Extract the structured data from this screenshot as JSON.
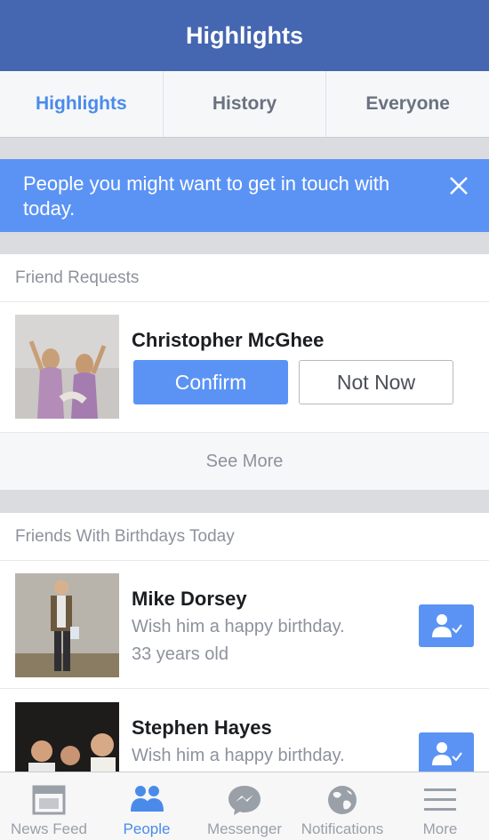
{
  "navbar": {
    "title": "Highlights"
  },
  "tabs": [
    {
      "label": "Highlights",
      "active": true
    },
    {
      "label": "History",
      "active": false
    },
    {
      "label": "Everyone",
      "active": false
    }
  ],
  "banner": {
    "text": "People you might want to get in touch with today."
  },
  "friend_requests": {
    "header": "Friend Requests",
    "name": "Christopher McGhee",
    "confirm_label": "Confirm",
    "not_now_label": "Not Now",
    "see_more_label": "See More"
  },
  "birthdays": {
    "header": "Friends With Birthdays Today",
    "people": [
      {
        "name": "Mike Dorsey",
        "message": "Wish him a happy birthday.",
        "age": "33 years old"
      },
      {
        "name": "Stephen Hayes",
        "message": "Wish him a happy birthday."
      }
    ]
  },
  "tabbar": [
    {
      "label": "News Feed",
      "icon": "news-feed-icon",
      "active": false
    },
    {
      "label": "People",
      "icon": "people-icon",
      "active": true
    },
    {
      "label": "Messenger",
      "icon": "messenger-icon",
      "active": false
    },
    {
      "label": "Notifications",
      "icon": "globe-icon",
      "active": false
    },
    {
      "label": "More",
      "icon": "menu-icon",
      "active": false
    }
  ],
  "colors": {
    "nav": "#4566b0",
    "accent": "#5b93f5",
    "active_tab": "#4a8bea"
  }
}
